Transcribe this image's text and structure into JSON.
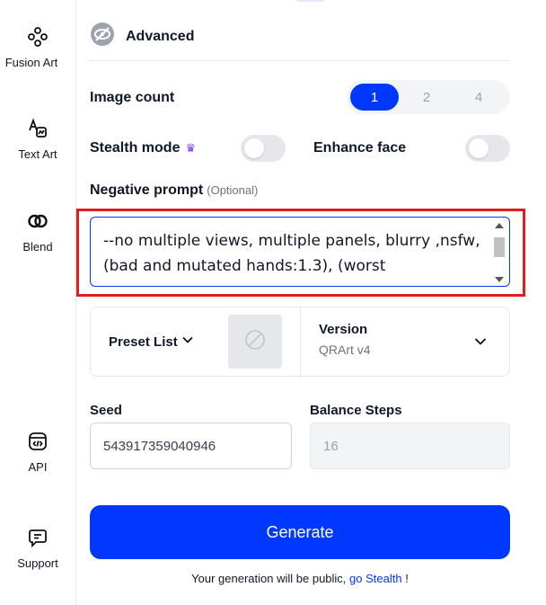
{
  "sidebar": {
    "items": [
      {
        "icon": "fusion-icon",
        "label": "Fusion Art"
      },
      {
        "icon": "text-art-icon",
        "label": "Text Art"
      },
      {
        "icon": "blend-icon",
        "label": "Blend"
      },
      {
        "icon": "api-icon",
        "label": "API"
      },
      {
        "icon": "support-icon",
        "label": "Support"
      }
    ]
  },
  "advanced": {
    "label": "Advanced",
    "icon": "eye-off-icon"
  },
  "image_count": {
    "label": "Image count",
    "options": [
      "1",
      "2",
      "4"
    ],
    "selected": "1"
  },
  "stealth": {
    "label": "Stealth mode",
    "on": false,
    "icon": "crown-icon"
  },
  "enhance_face": {
    "label": "Enhance face",
    "on": false
  },
  "negative_prompt": {
    "label": "Negative prompt",
    "optional": "(Optional)",
    "value": "--no multiple views, multiple panels, blurry ,nsfw,(bad and mutated hands:1.3), (worst"
  },
  "preset": {
    "label": "Preset List",
    "icon": "ban-icon"
  },
  "version": {
    "label": "Version",
    "value": "QRArt v4"
  },
  "seed": {
    "label": "Seed",
    "value": "543917359040946"
  },
  "balance_steps": {
    "label": "Balance Steps",
    "value": "16"
  },
  "generate": {
    "label": "Generate"
  },
  "public_note": {
    "text": "Your generation will be public, ",
    "link": "go Stealth",
    "suffix": " !"
  },
  "colors": {
    "accent": "#0038ff",
    "highlight": "#e11d1d"
  }
}
